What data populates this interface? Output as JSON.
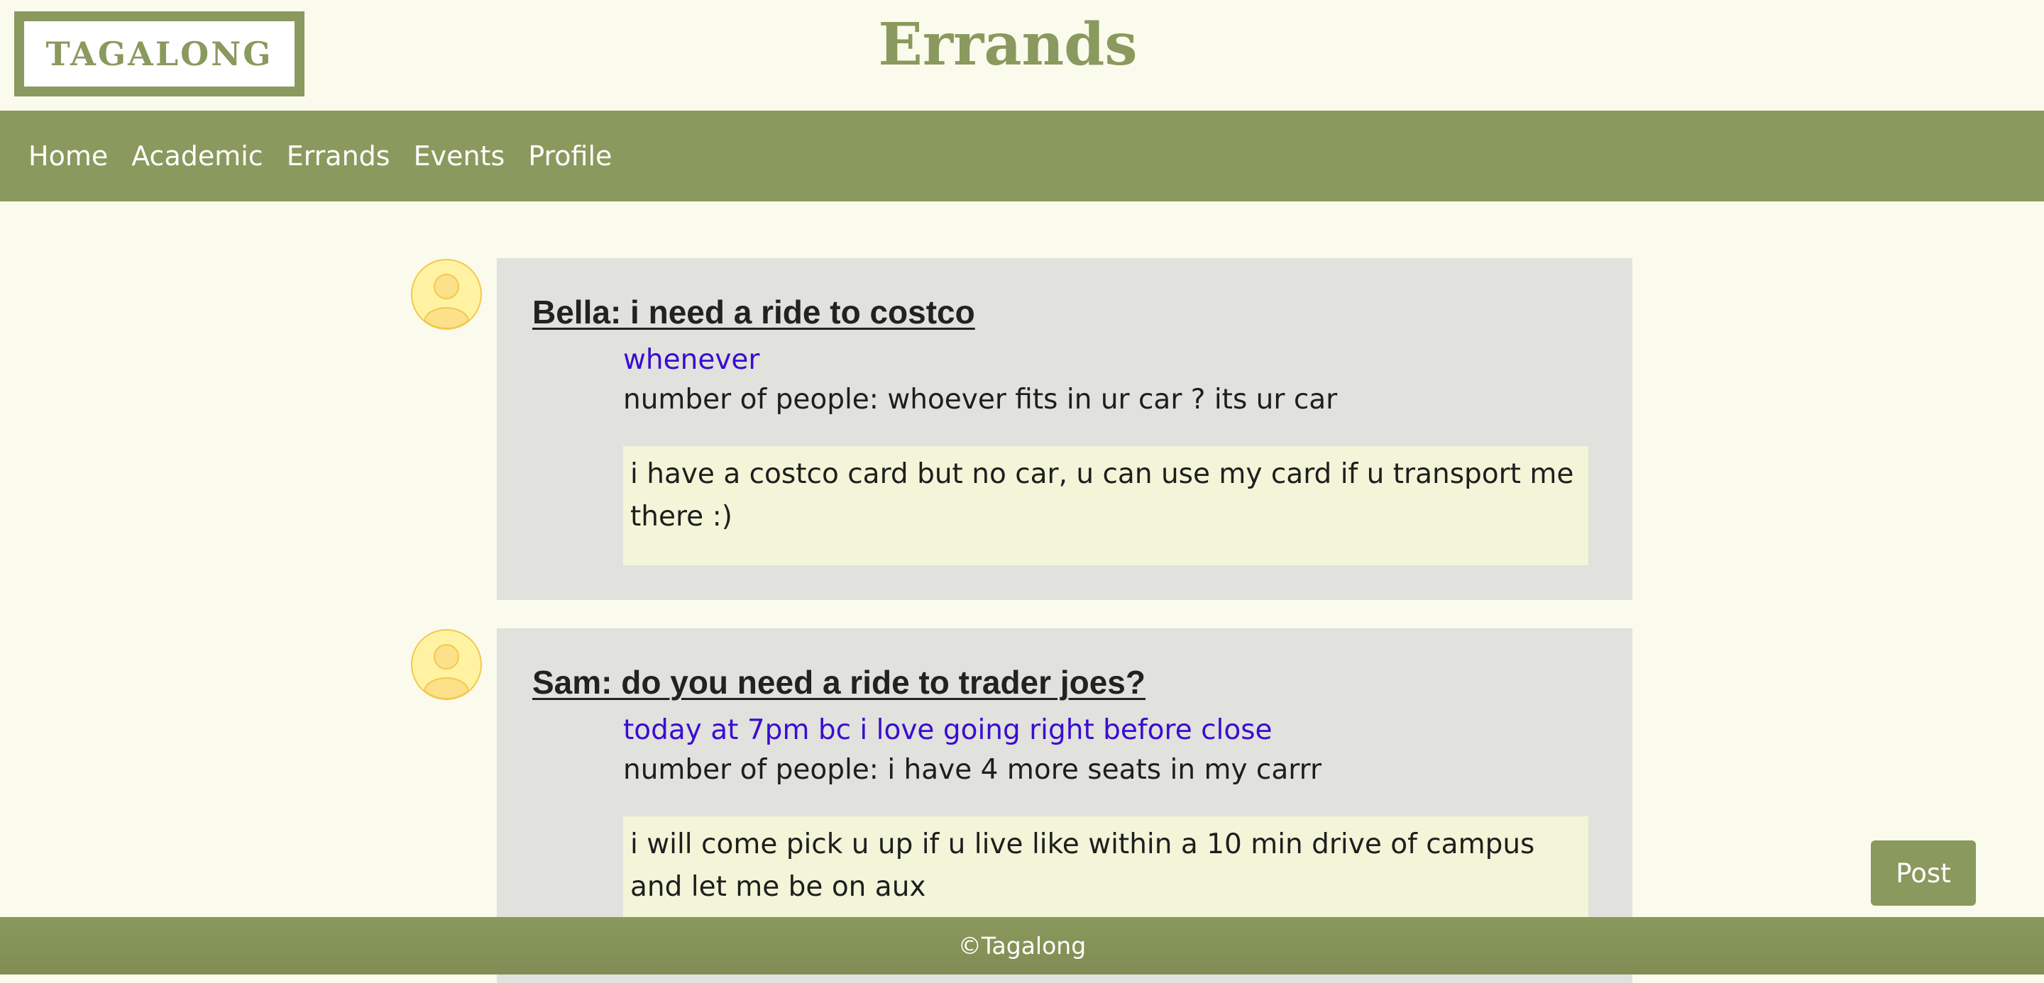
{
  "app": {
    "logo_text": "TAGALONG",
    "page_title": "Errands"
  },
  "nav": {
    "items": [
      {
        "label": "Home"
      },
      {
        "label": "Academic"
      },
      {
        "label": "Errands"
      },
      {
        "label": "Events"
      },
      {
        "label": "Profile"
      }
    ]
  },
  "posts": [
    {
      "title": "Bella: i need a ride to costco",
      "when": "whenever",
      "people": "number of people: whoever fits in ur car ? its ur car",
      "description": "i have a costco card but no car, u can use my card if u transport me there :)",
      "avatar_icon": "user-avatar-icon"
    },
    {
      "title": "Sam: do you need a ride to trader joes?",
      "when": "today at 7pm bc i love going right before close",
      "people": "number of people: i have 4 more seats in my carrr",
      "description": "i will come pick u up if u live like within a 10 min drive of campus and let me be on aux",
      "avatar_icon": "user-avatar-icon"
    }
  ],
  "actions": {
    "post_label": "Post"
  },
  "footer": {
    "text": "©Tagalong"
  },
  "colors": {
    "brand": "#8a995d",
    "background": "#fafbec",
    "card": "#e1e1de",
    "description_bg": "#f3f5d8",
    "when_text": "#3a0ccf",
    "avatar_fill": "#fff3a3",
    "avatar_stroke": "#f2c94c"
  }
}
